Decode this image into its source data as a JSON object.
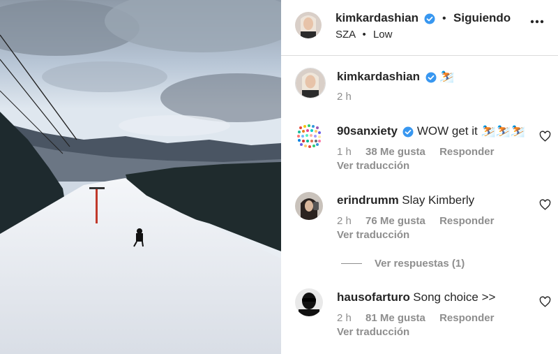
{
  "post": {
    "author": "kimkardashian",
    "follow_state": "Siguiendo",
    "audio": {
      "artist": "SZA",
      "song": "Low"
    },
    "caption_emoji": "⛷️",
    "caption_time": "2 h"
  },
  "comments": [
    {
      "user": "90sanxiety",
      "verified": true,
      "text": "WOW get it ⛷️⛷️⛷️",
      "time": "1 h",
      "likes": "38 Me gusta",
      "reply": "Responder",
      "translate": "Ver traducción"
    },
    {
      "user": "erindrumm",
      "verified": false,
      "text": "Slay Kimberly",
      "time": "2 h",
      "likes": "76 Me gusta",
      "reply": "Responder",
      "translate": "Ver traducción"
    },
    {
      "user": "hausofarturo",
      "verified": false,
      "text": "Song choice >>",
      "time": "2 h",
      "likes": "81 Me gusta",
      "reply": "Responder",
      "translate": "Ver traducción"
    }
  ],
  "view_replies": "Ver respuestas (1)",
  "icons": {
    "verified": "verified-badge-icon",
    "more": "more-options-icon",
    "heart": "heart-outline-icon"
  },
  "colors": {
    "verified": "#3897f0",
    "text": "#262626",
    "secondary": "#8e8e8e"
  }
}
